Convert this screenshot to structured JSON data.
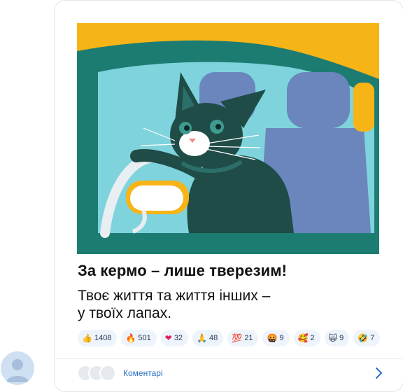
{
  "post": {
    "title": "За кермо – лише тверезим!",
    "text_line1": "Твоє життя та життя інших –",
    "text_line2": "у твоїх лапах."
  },
  "reactions": [
    {
      "icon": "thumbs-up-icon",
      "emoji": "👍",
      "count": "1408"
    },
    {
      "icon": "fire-icon",
      "emoji": "🔥",
      "count": "501"
    },
    {
      "icon": "heart-icon",
      "emoji": "❤",
      "count": "32"
    },
    {
      "icon": "pray-icon",
      "emoji": "🙏",
      "count": "48"
    },
    {
      "icon": "hundred-icon",
      "emoji": "💯",
      "count": "21"
    },
    {
      "icon": "angry-face-icon",
      "emoji": "🤬",
      "count": "9"
    },
    {
      "icon": "smiling-hearts-icon",
      "emoji": "🥰",
      "count": "2"
    },
    {
      "icon": "scream-icon",
      "emoji": "🙀",
      "count": "9"
    },
    {
      "icon": "laugh-icon",
      "emoji": "🤣",
      "count": "7"
    }
  ],
  "footer": {
    "comments_label": "Коментарі"
  },
  "colors": {
    "background_yellow": "#f6b417",
    "car_teal": "#1d7c72",
    "cat_dark": "#1f4c47",
    "seat_blue": "#6a86bd",
    "link_blue": "#2a6fc4"
  }
}
